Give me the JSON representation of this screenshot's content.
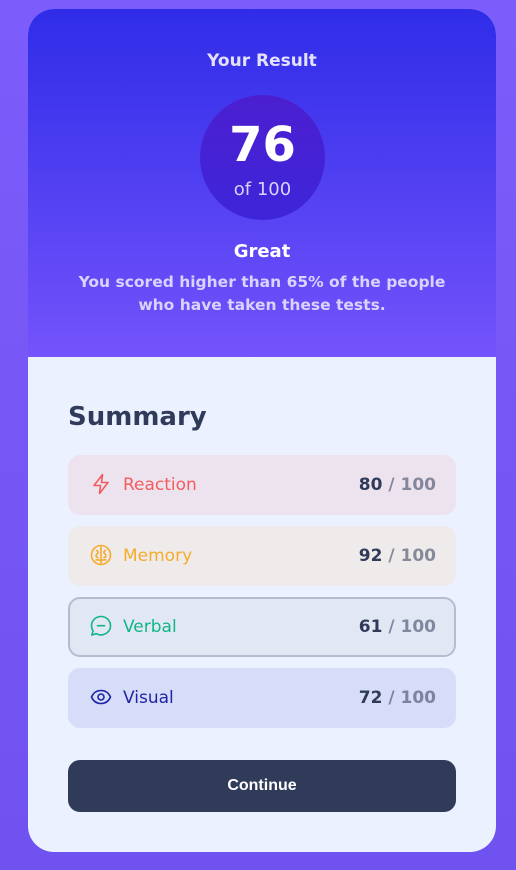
{
  "result": {
    "heading": "Your Result",
    "score": "76",
    "score_max": "of 100",
    "rating": "Great",
    "description": "You scored higher than 65% of the people who have taken these tests."
  },
  "summary": {
    "title": "Summary",
    "items": [
      {
        "label": "Reaction",
        "score": "80",
        "max": "/ 100",
        "icon": "lightning-icon",
        "color": "#f25c5c"
      },
      {
        "label": "Memory",
        "score": "92",
        "max": "/ 100",
        "icon": "brain-icon",
        "color": "#f5ac2b"
      },
      {
        "label": "Verbal",
        "score": "61",
        "max": "/ 100",
        "icon": "chat-bubble-icon",
        "color": "#10b58a"
      },
      {
        "label": "Visual",
        "score": "72",
        "max": "/ 100",
        "icon": "eye-icon",
        "color": "#1d25a5"
      }
    ]
  },
  "continue_label": "Continue"
}
